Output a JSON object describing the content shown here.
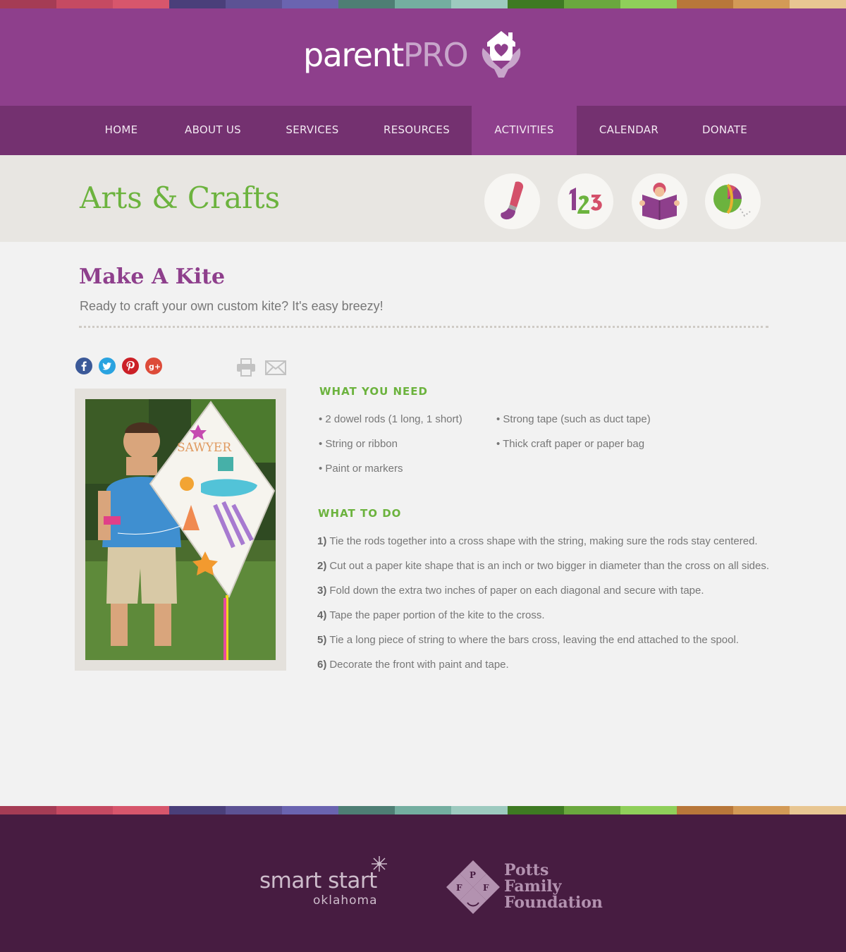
{
  "stripe_colors": [
    "#a53c55",
    "#c54a62",
    "#d7566c",
    "#4a3f7a",
    "#5c5294",
    "#6a64b0",
    "#4e7e74",
    "#74aea0",
    "#9dcabf",
    "#3e7a22",
    "#6aa83e",
    "#8fcf5a",
    "#b8773a",
    "#d39a56",
    "#e8c692"
  ],
  "header": {
    "logo_parent": "parent",
    "logo_pro": "PRO"
  },
  "nav": {
    "items": [
      {
        "label": "HOME"
      },
      {
        "label": "ABOUT US"
      },
      {
        "label": "SERVICES"
      },
      {
        "label": "RESOURCES"
      },
      {
        "label": "ACTIVITIES",
        "active": true
      },
      {
        "label": "CALENDAR"
      },
      {
        "label": "DONATE"
      }
    ]
  },
  "category": {
    "title": "Arts & Crafts",
    "icons": [
      "paintbrush-icon",
      "numbers-123-icon",
      "reading-book-icon",
      "ball-icon"
    ]
  },
  "activity": {
    "title": "Make A Kite",
    "subtitle": "Ready to craft your own custom kite? It's easy breezy!",
    "photo_kite_text": "SAWYER",
    "share_icons": [
      "facebook-icon",
      "twitter-icon",
      "pinterest-icon",
      "google-plus-icon"
    ],
    "utility_icons": [
      "print-icon",
      "email-icon"
    ],
    "need_heading": "WHAT YOU NEED",
    "need_items": [
      "• 2 dowel rods (1 long, 1 short)",
      "• Strong tape (such as duct tape)",
      "• String or ribbon",
      "• Thick craft paper or paper bag",
      "• Paint or markers"
    ],
    "do_heading": "WHAT TO DO",
    "steps": [
      {
        "num": "1)",
        "text": "Tie the rods together into a cross shape with the string, making sure the rods stay centered."
      },
      {
        "num": "2)",
        "text": "Cut out a paper kite shape that is an inch or two bigger in diameter than the cross on all sides."
      },
      {
        "num": "3)",
        "text": "Fold down the extra two inches of paper on each diagonal and secure with tape."
      },
      {
        "num": "4)",
        "text": "Tape the paper portion of the kite to the cross."
      },
      {
        "num": "5)",
        "text": "Tie a long piece of string to where the bars cross, leaving the end attached to the spool."
      },
      {
        "num": "6)",
        "text": "Decorate the front with paint and tape."
      }
    ]
  },
  "footer": {
    "sponsor1_main": "smart start",
    "sponsor1_sub": "oklahoma",
    "sponsor2_lines": [
      "Potts",
      "Family",
      "Foundation"
    ],
    "sponsor2_letters": [
      "P",
      "F",
      "F"
    ]
  }
}
